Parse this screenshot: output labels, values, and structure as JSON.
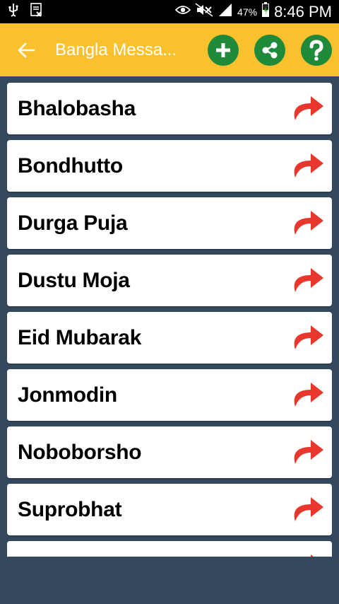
{
  "status_bar": {
    "icons": [
      "usb-icon",
      "image-x-icon",
      "eye-icon",
      "mute-icon",
      "signal-icon",
      "battery-icon"
    ],
    "battery_percent": "47%",
    "time": "8:46 PM"
  },
  "app_bar": {
    "title": "Bangla Messa...",
    "background": "#f9c12e",
    "action_color": "#1f8a3a",
    "actions": [
      "add-icon",
      "share-icon",
      "help-icon"
    ]
  },
  "list": {
    "items": [
      {
        "label": "Bhalobasha"
      },
      {
        "label": "Bondhutto"
      },
      {
        "label": "Durga Puja"
      },
      {
        "label": "Dustu Moja"
      },
      {
        "label": "Eid Mubarak"
      },
      {
        "label": "Jonmodin"
      },
      {
        "label": "Noboborsho"
      },
      {
        "label": "Suprobhat"
      },
      {
        "label": ""
      }
    ],
    "item_icon": "forward-arrow-icon",
    "item_icon_color": "#e8372c"
  },
  "background": "#34495e"
}
